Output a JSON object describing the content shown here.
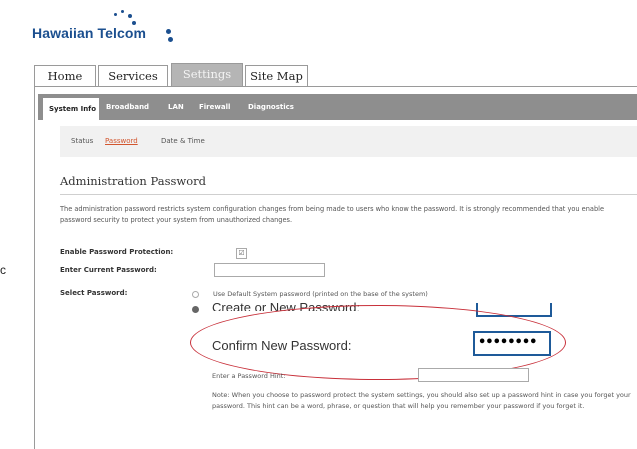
{
  "logo": {
    "brand": "Hawaiian Telcom"
  },
  "top_tabs": [
    "Home",
    "Services",
    "Settings",
    "Site Map"
  ],
  "active_top_tab": "Settings",
  "sub_tabs": [
    "System Info",
    "Broadband",
    "LAN",
    "Firewall",
    "Diagnostics"
  ],
  "active_sub_tab": "System Info",
  "sub_sub_tabs": [
    "Status",
    "Password",
    "Date & Time"
  ],
  "active_sub_sub_tab": "Password",
  "section_title": "Administration Password",
  "description": "The administration password restricts system configuration changes from being made to users who know the password. It is strongly recommended that you enable password security to protect your system from unauthorized changes.",
  "form": {
    "enable_label": "Enable Password Protection:",
    "enable_checked": true,
    "enable_check_glyph": "☑",
    "current_label": "Enter Current Password:",
    "current_value": "",
    "select_label": "Select Password:",
    "option_default": "Use Default System password (printed on the base of the system)",
    "option_create_partial": "Create or New Password:",
    "confirm_label": "Confirm New Password:",
    "confirm_value": "••••••••",
    "hint_label": "Enter a Password Hint:",
    "hint_value": "",
    "note": "Note: When you choose to password protect the system settings, you should also set up a password hint in case you forget your password. This hint can be a word, phrase, or question that will help you remember your password if you forget it."
  },
  "left_edge_char": "c",
  "colors": {
    "brand": "#1b4f8f",
    "highlight": "#c8303a",
    "field_border": "#1e5a99",
    "active_link": "#d2562f"
  }
}
